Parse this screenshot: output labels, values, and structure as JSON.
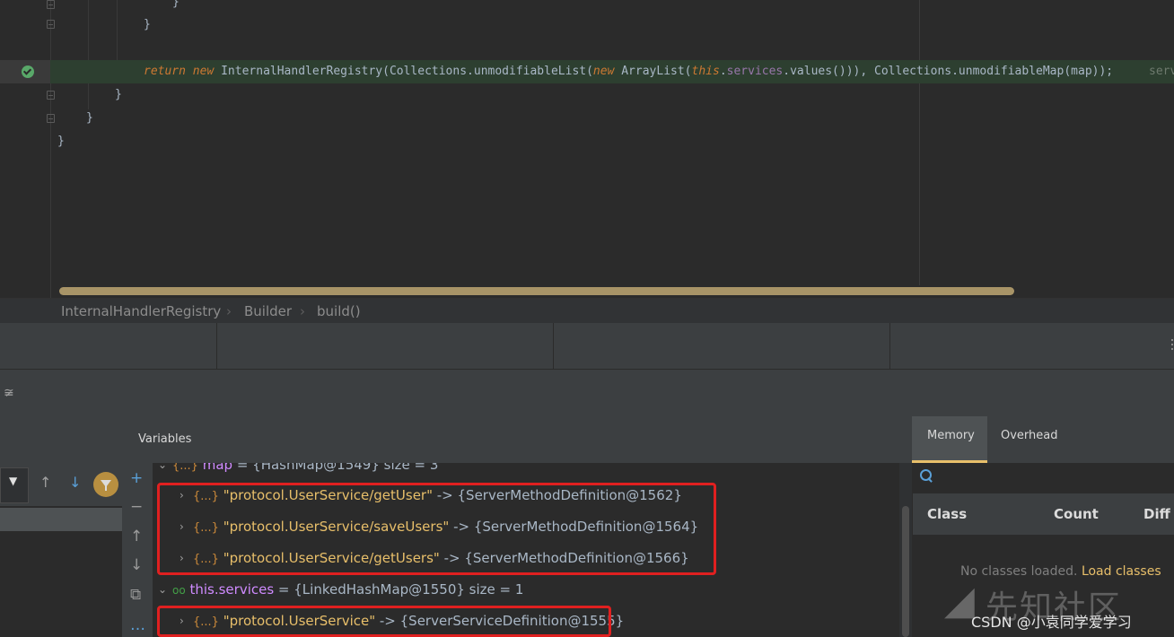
{
  "editor": {
    "lines": [
      {
        "text": "}"
      },
      {
        "text": "}"
      },
      {
        "text": "return new InternalHandlerRegistry(Collections.unmodifiableList(new ArrayList(this.services.values())), Collections.unmodifiableMap(map));"
      },
      {
        "hint": "serv"
      },
      {
        "text": "}"
      },
      {
        "text": "}"
      },
      {
        "text": "}"
      }
    ],
    "tokens": {
      "return": "return",
      "new1": "new",
      "registry": " InternalHandlerRegistry(Collections.unmodifiableList(",
      "new2": "new",
      "arraylist": " ArrayList(",
      "this": "this",
      "dot1": ".",
      "services": "services",
      "rest": ".values())), Collections.unmodifiableMap(",
      "map": "map",
      "end": "));",
      "hint": "serv"
    }
  },
  "breadcrumb": {
    "items": [
      "InternalHandlerRegistry",
      "Builder",
      "build()"
    ]
  },
  "debug": {
    "variables_title": "Variables",
    "variables": [
      {
        "icon": "{...}",
        "name": "map",
        "value": " = {HashMap@1549}  size = 3"
      },
      {
        "icon": "{...}",
        "key": "\"protocol.UserService/getUser\"",
        "value": " -> {ServerMethodDefinition@1562}"
      },
      {
        "icon": "{...}",
        "key": "\"protocol.UserService/saveUsers\"",
        "value": " -> {ServerMethodDefinition@1564}"
      },
      {
        "icon": "{...}",
        "key": "\"protocol.UserService/getUsers\"",
        "value": " -> {ServerMethodDefinition@1566}"
      },
      {
        "icon": "oo",
        "name": "this.services",
        "value": " = {LinkedHashMap@1550}  size = 1"
      },
      {
        "icon": "{...}",
        "key": "\"protocol.UserService\"",
        "value": " -> {ServerServiceDefinition@1555}"
      }
    ],
    "side_toolbar": [
      "+",
      "−",
      "↑",
      "↓",
      "⧉",
      "…"
    ]
  },
  "memory": {
    "tabs": [
      "Memory",
      "Overhead"
    ],
    "columns": [
      "Class",
      "Count",
      "Diff"
    ],
    "empty_text": "No classes loaded.",
    "load_link": "Load classes"
  },
  "watermark": {
    "logo_text": "先知社区",
    "credit": "CSDN @小袁同学爱学习"
  },
  "colors": {
    "keyword": "#cc7832",
    "field": "#9876aa",
    "string": "#e8bf6a",
    "highlight_box": "#e02020",
    "accent": "#e8bf6a"
  }
}
